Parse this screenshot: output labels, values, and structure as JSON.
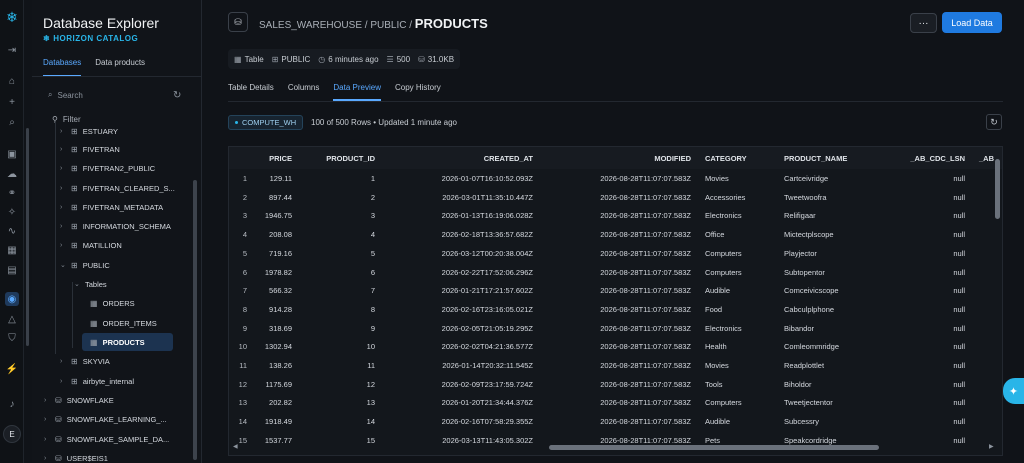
{
  "rail": {
    "icons": [
      "snowflake-logo-icon",
      "collapse-icon",
      "home-icon",
      "add-icon",
      "search-icon",
      "projects-icon",
      "data-icon",
      "ai-ml-icon",
      "monitoring-icon",
      "marketplace-icon",
      "apps-icon",
      "catalog-icon",
      "horizon-icon",
      "governance-icon",
      "admin-icon",
      "notifications-icon"
    ],
    "avatar": "E"
  },
  "explorer": {
    "title": "Database Explorer",
    "subtitle": "HORIZON CATALOG",
    "tabs": [
      {
        "label": "Databases"
      },
      {
        "label": "Data products"
      }
    ],
    "search_placeholder": "Search",
    "filter_label": "Filter",
    "tree": [
      {
        "label": "ESTUARY"
      },
      {
        "label": "FIVETRAN"
      },
      {
        "label": "FIVETRAN2_PUBLIC"
      },
      {
        "label": "FIVETRAN_CLEARED_S..."
      },
      {
        "label": "FIVETRAN_METADATA"
      },
      {
        "label": "INFORMATION_SCHEMA"
      },
      {
        "label": "MATILLION"
      },
      {
        "label": "PUBLIC"
      },
      {
        "label": "Tables"
      },
      {
        "label": "ORDERS"
      },
      {
        "label": "ORDER_ITEMS"
      },
      {
        "label": "PRODUCTS"
      },
      {
        "label": "SKYVIA"
      },
      {
        "label": "airbyte_internal"
      },
      {
        "label": "SNOWFLAKE"
      },
      {
        "label": "SNOWFLAKE_LEARNING_..."
      },
      {
        "label": "SNOWFLAKE_SAMPLE_DA..."
      },
      {
        "label": "USER$EIS1"
      }
    ]
  },
  "header": {
    "breadcrumb_path": "SALES_WAREHOUSE / PUBLIC / ",
    "breadcrumb_current": "PRODUCTS",
    "more_label": "···",
    "load_button": "Load Data"
  },
  "meta": {
    "type": "Table",
    "schema": "PUBLIC",
    "updated": "6 minutes ago",
    "rows": "500",
    "size": "31.0KB"
  },
  "tabs": [
    {
      "label": "Table Details"
    },
    {
      "label": "Columns"
    },
    {
      "label": "Data Preview"
    },
    {
      "label": "Copy History"
    }
  ],
  "preview": {
    "warehouse": "COMPUTE_WH",
    "info": "100 of 500 Rows • Updated 1 minute ago",
    "columns": [
      "PRICE",
      "PRODUCT_ID",
      "CREATED_AT",
      "MODIFIED",
      "CATEGORY",
      "PRODUCT_NAME",
      "_AB_CDC_LSN",
      "_AB"
    ],
    "rows": [
      {
        "n": "1",
        "price": "129.11",
        "id": "1",
        "created": "2026-01-07T16:10:52.093Z",
        "modified": "2026-08-28T11:07:07.583Z",
        "category": "Movies",
        "name": "Cartceivridge",
        "lsn": "null"
      },
      {
        "n": "2",
        "price": "897.44",
        "id": "2",
        "created": "2026-03-01T11:35:10.447Z",
        "modified": "2026-08-28T11:07:07.583Z",
        "category": "Accessories",
        "name": "Tweetwoofra",
        "lsn": "null"
      },
      {
        "n": "3",
        "price": "1946.75",
        "id": "3",
        "created": "2026-01-13T16:19:06.028Z",
        "modified": "2026-08-28T11:07:07.583Z",
        "category": "Electronics",
        "name": "Relifigaar",
        "lsn": "null"
      },
      {
        "n": "4",
        "price": "208.08",
        "id": "4",
        "created": "2026-02-18T13:36:57.682Z",
        "modified": "2026-08-28T11:07:07.583Z",
        "category": "Office",
        "name": "Mictectplscope",
        "lsn": "null"
      },
      {
        "n": "5",
        "price": "719.16",
        "id": "5",
        "created": "2026-03-12T00:20:38.004Z",
        "modified": "2026-08-28T11:07:07.583Z",
        "category": "Computers",
        "name": "Playjector",
        "lsn": "null"
      },
      {
        "n": "6",
        "price": "1978.82",
        "id": "6",
        "created": "2026-02-22T17:52:06.296Z",
        "modified": "2026-08-28T11:07:07.583Z",
        "category": "Computers",
        "name": "Subtopentor",
        "lsn": "null"
      },
      {
        "n": "7",
        "price": "566.32",
        "id": "7",
        "created": "2026-01-21T17:21:57.602Z",
        "modified": "2026-08-28T11:07:07.583Z",
        "category": "Audible",
        "name": "Comceivicscope",
        "lsn": "null"
      },
      {
        "n": "8",
        "price": "914.28",
        "id": "8",
        "created": "2026-02-16T23:16:05.021Z",
        "modified": "2026-08-28T11:07:07.583Z",
        "category": "Food",
        "name": "Cabculplphone",
        "lsn": "null"
      },
      {
        "n": "9",
        "price": "318.69",
        "id": "9",
        "created": "2026-02-05T21:05:19.295Z",
        "modified": "2026-08-28T11:07:07.583Z",
        "category": "Electronics",
        "name": "Bibandor",
        "lsn": "null"
      },
      {
        "n": "10",
        "price": "1302.94",
        "id": "10",
        "created": "2026-02-02T04:21:36.577Z",
        "modified": "2026-08-28T11:07:07.583Z",
        "category": "Health",
        "name": "Comleommridge",
        "lsn": "null"
      },
      {
        "n": "11",
        "price": "138.26",
        "id": "11",
        "created": "2026-01-14T20:32:11.545Z",
        "modified": "2026-08-28T11:07:07.583Z",
        "category": "Movies",
        "name": "Readplottlet",
        "lsn": "null"
      },
      {
        "n": "12",
        "price": "1175.69",
        "id": "12",
        "created": "2026-02-09T23:17:59.724Z",
        "modified": "2026-08-28T11:07:07.583Z",
        "category": "Tools",
        "name": "Biholdor",
        "lsn": "null"
      },
      {
        "n": "13",
        "price": "202.82",
        "id": "13",
        "created": "2026-01-20T21:34:44.376Z",
        "modified": "2026-08-28T11:07:07.583Z",
        "category": "Computers",
        "name": "Tweetjectentor",
        "lsn": "null"
      },
      {
        "n": "14",
        "price": "1918.49",
        "id": "14",
        "created": "2026-02-16T07:58:29.355Z",
        "modified": "2026-08-28T11:07:07.583Z",
        "category": "Audible",
        "name": "Subcessry",
        "lsn": "null"
      },
      {
        "n": "15",
        "price": "1537.77",
        "id": "15",
        "created": "2026-03-13T11:43:05.302Z",
        "modified": "2026-08-28T11:07:07.583Z",
        "category": "Pets",
        "name": "Speakcordridge",
        "lsn": "null"
      }
    ]
  },
  "assistant_icon": "sparkle-icon"
}
